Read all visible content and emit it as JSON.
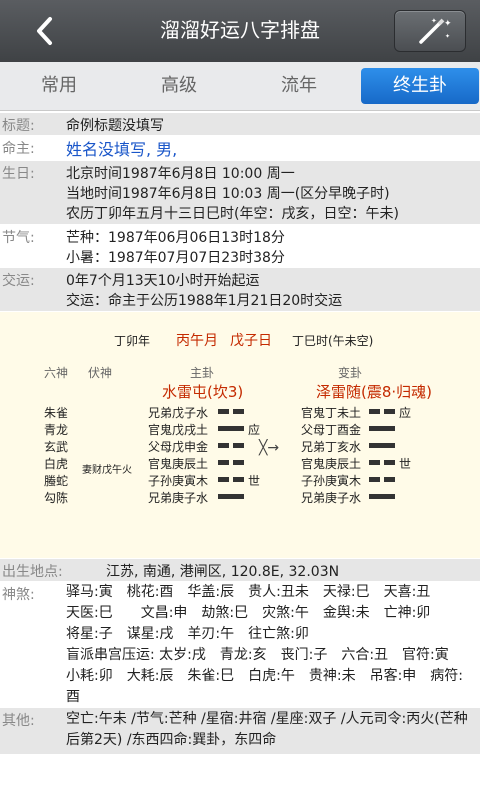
{
  "header": {
    "title": "溜溜好运八字排盘"
  },
  "tabs": [
    {
      "label": "常用",
      "active": false
    },
    {
      "label": "高级",
      "active": false
    },
    {
      "label": "流年",
      "active": false
    },
    {
      "label": "终生卦",
      "active": true
    }
  ],
  "info": {
    "title_label": "标题:",
    "title_value": "命例标题没填写",
    "owner_label": "命主:",
    "owner_value": "姓名没填写, 男,",
    "birth_label": "生日:",
    "birth_lines": [
      "北京时间1987年6月8日 10:00 周一",
      "当地时间1987年6月8日 10:03 周一(区分早晚子时)",
      "农历丁卯年五月十三日巳时(年空：戌亥，日空：午未)"
    ],
    "jieqi_label": "节气:",
    "jieqi_lines": [
      "芒种：1987年06月06日13时18分",
      "小暑：1987年07月07日23时38分"
    ],
    "jiaoyun_label": "交运:",
    "jiaoyun_lines": [
      "0年7个月13天10小时开始起运",
      "交运：命主于公历1988年1月21日20时交运"
    ]
  },
  "chart": {
    "pillars": {
      "year": "丁卯年",
      "month": "丙午月",
      "day": "戊子日",
      "hour": "丁巳时(午未空)"
    },
    "headers": {
      "liushen": "六神",
      "fushen": "伏神",
      "main": "主卦",
      "change": "变卦"
    },
    "main_name": "水雷屯(坎3)",
    "change_name": "泽雷随(震8·归魂)",
    "liushen": [
      "朱雀",
      "青龙",
      "玄武",
      "白虎",
      "螣蛇",
      "勾陈"
    ],
    "fushen_note": "妻财戊午火",
    "main_lines": [
      "兄弟戊子水",
      "官鬼戊戌土",
      "父母戊申金",
      "官鬼庚辰土",
      "子孙庚寅木",
      "兄弟庚子水"
    ],
    "main_marks": [
      "",
      "应",
      "",
      "",
      "世",
      ""
    ],
    "main_yao": [
      "yin",
      "yang",
      "yin",
      "yin",
      "yin",
      "yang"
    ],
    "moving_mark": "╳→",
    "change_lines": [
      "官鬼丁未土",
      "父母丁酉金",
      "兄弟丁亥水",
      "官鬼庚辰土",
      "子孙庚寅木",
      "兄弟庚子水"
    ],
    "change_marks": [
      "应",
      "",
      "",
      "世",
      "",
      ""
    ],
    "change_yao": [
      "yin",
      "yang",
      "yang",
      "yin",
      "yin",
      "yang"
    ]
  },
  "birthplace": {
    "label": "出生地点:",
    "value": "江苏, 南通, 港闸区, 120.8E, 32.03N"
  },
  "shensha": {
    "label": "神煞:",
    "lines": [
      "驿马:寅　桃花:酉　华盖:辰　贵人:丑未　天禄:巳　天喜:丑",
      "天医:巳　　文昌:申　劫煞:巳　灾煞:午　金舆:未　亡神:卯",
      "将星:子　谋星:戌　羊刃:午　往亡煞:卯",
      "盲派串宫压运: 太岁:戌　青龙:亥　丧门:子　六合:丑　官符:寅　小耗:卯　大耗:辰　朱雀:巳　白虎:午　贵神:未　吊客:申　病符:酉"
    ]
  },
  "other": {
    "label": "其他:",
    "value": "空亡:午未 /节气:芒种 /星宿:井宿 /星座:双子 /人元司令:丙火(芒种后第2天) /东西四命:巽卦，东四命"
  }
}
